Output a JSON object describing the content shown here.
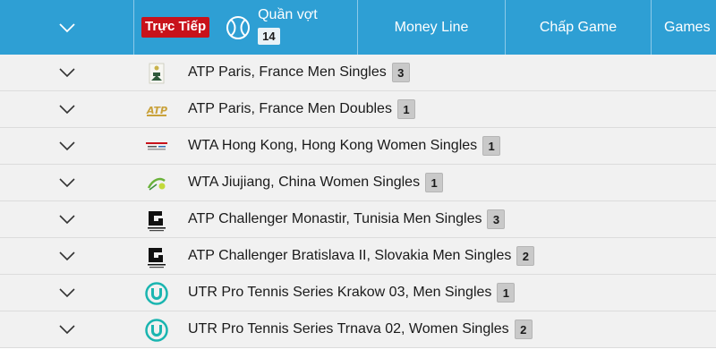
{
  "header": {
    "live_label": "Trực Tiếp",
    "sport_name": "Quần vợt",
    "sport_count": "14",
    "sport_icon": "tennis-ball-icon",
    "columns": [
      "Money Line",
      "Chấp Game",
      "Games"
    ]
  },
  "leagues": [
    {
      "name": "ATP Paris, France Men Singles",
      "count": "3",
      "logo": "atp-paris-logo"
    },
    {
      "name": "ATP Paris, France Men Doubles",
      "count": "1",
      "logo": "atp-gold-logo"
    },
    {
      "name": "WTA Hong Kong, Hong Kong Women Singles",
      "count": "1",
      "logo": "wta-hong-kong-logo"
    },
    {
      "name": "WTA Jiujiang, China Women Singles",
      "count": "1",
      "logo": "wta-jiujiang-logo"
    },
    {
      "name": "ATP Challenger Monastir, Tunisia Men Singles",
      "count": "3",
      "logo": "atp-challenger-logo"
    },
    {
      "name": "ATP Challenger Bratislava II, Slovakia Men Singles",
      "count": "2",
      "logo": "atp-challenger-logo"
    },
    {
      "name": "UTR Pro Tennis Series Krakow 03, Men Singles",
      "count": "1",
      "logo": "utr-logo"
    },
    {
      "name": "UTR Pro Tennis Series Trnava 02, Women Singles",
      "count": "2",
      "logo": "utr-logo"
    }
  ],
  "colors": {
    "header_bg": "#2e9fd4",
    "live_badge": "#c8121b",
    "row_bg": "#f1f1f1",
    "count_badge": "#c9c9c9",
    "utr_teal": "#1ab5b0"
  }
}
